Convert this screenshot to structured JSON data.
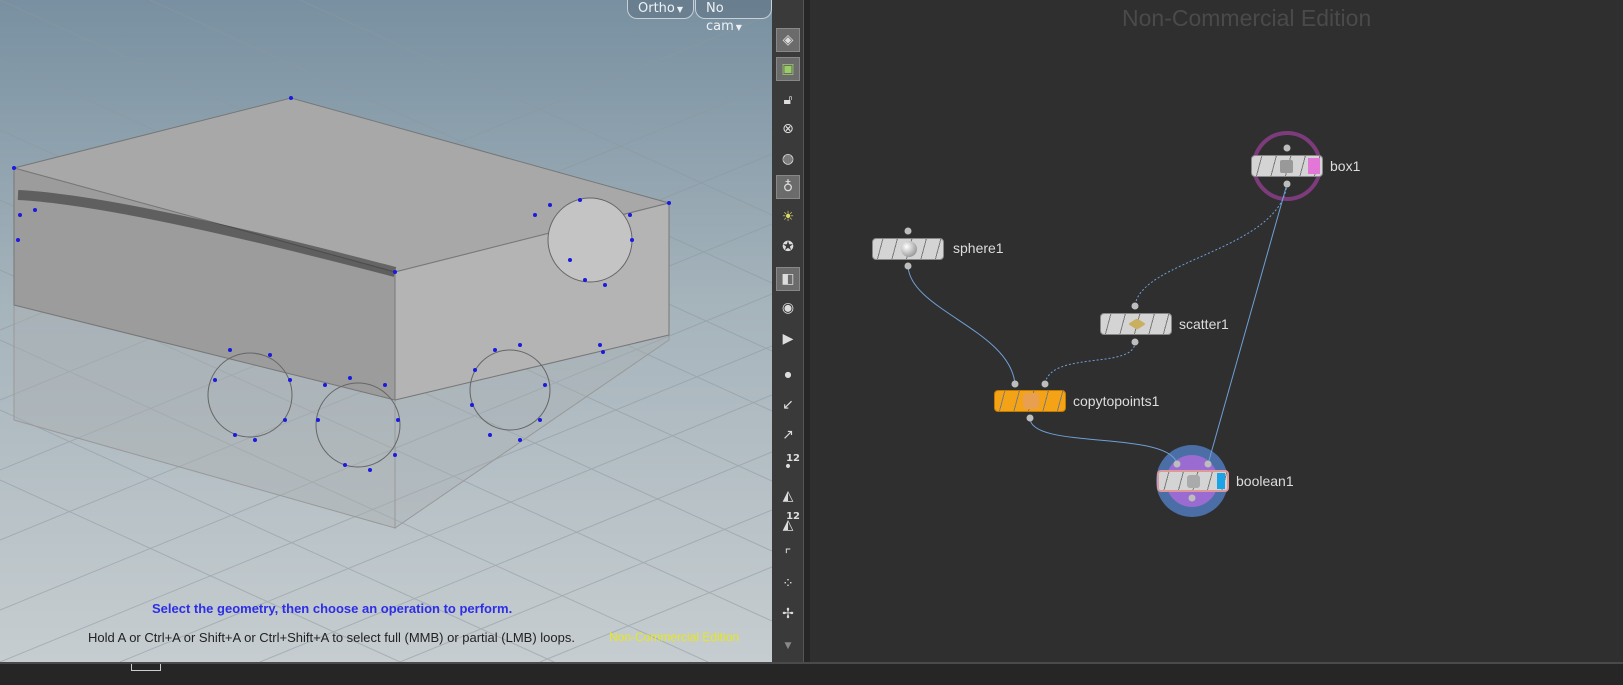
{
  "viewport": {
    "camera_view": "Ortho",
    "camera": "No cam",
    "hint_primary": "Select the geometry, then choose an operation to perform.",
    "hint_secondary": "Hold A or Ctrl+A or Shift+A or Ctrl+Shift+A to select full (MMB) or partial (LMB) loops.",
    "watermark": "Non-Commercial Edition"
  },
  "toolbar": {
    "icons": [
      "select-mode-icon",
      "snapping-icon",
      "lock-icon",
      "close-icon",
      "shading-icon",
      "light-icon",
      "headlight-icon",
      "light-2-icon",
      "display-options-icon",
      "eye-icon",
      "render-icon",
      "point-icon",
      "normal-icon",
      "vector-icon",
      "point-number-icon",
      "primitive-icon",
      "primitive-number-icon",
      "edge-icon",
      "vertex-icon",
      "origin-icon"
    ],
    "point_number_label": "12",
    "primitive_number_label": "12"
  },
  "network": {
    "watermark": "Non-Commercial Edition",
    "nodes": [
      {
        "name": "sphere1",
        "type": "sphere"
      },
      {
        "name": "scatter1",
        "type": "scatter"
      },
      {
        "name": "copytopoints1",
        "type": "copytopoints",
        "color": "#f5a316"
      },
      {
        "name": "box1",
        "type": "box",
        "flag": "template",
        "flag_color": "#e277d8"
      },
      {
        "name": "boolean1",
        "type": "boolean",
        "flag": "display",
        "flag_color": "#1aa3e6"
      }
    ]
  },
  "colors": {
    "hint_primary": "#2d2ee6",
    "watermark": "#e8e81a",
    "wire": "#6f9fd6",
    "box_ring": "#7c3b7a",
    "boolean_ring": "#4b6ea6"
  }
}
